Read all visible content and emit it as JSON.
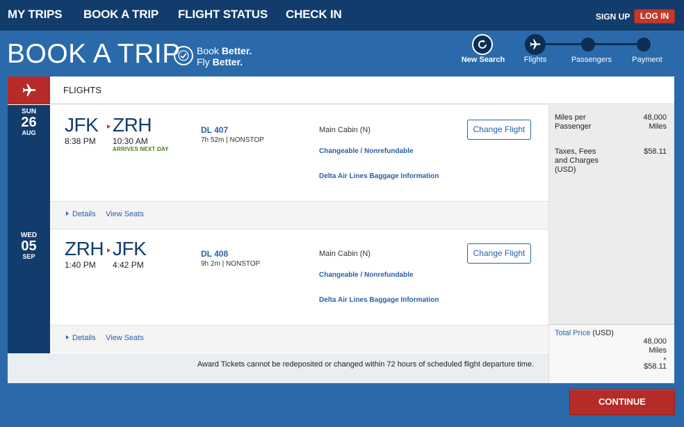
{
  "nav": {
    "items": [
      "MY TRIPS",
      "BOOK A TRIP",
      "FLIGHT STATUS",
      "CHECK IN"
    ],
    "sign_up": "SIGN UP",
    "log_in": "LOG IN"
  },
  "header": {
    "title": "BOOK A TRIP",
    "brand_line1_a": "Book ",
    "brand_line1_b": "Better.",
    "brand_line2_a": "Fly ",
    "brand_line2_b": "Better."
  },
  "steps": {
    "new_search": "New Search",
    "flights": "Flights",
    "passengers": "Passengers",
    "payment": "Payment"
  },
  "panel": {
    "section_label": "FLIGHTS"
  },
  "segments": [
    {
      "dow": "SUN",
      "day": "26",
      "month": "AUG",
      "from": "JFK",
      "to": "ZRH",
      "depart_time": "8:38 PM",
      "arrive_time": "10:30 AM",
      "arrives_note": "ARRIVES NEXT DAY",
      "flight_number": "DL 407",
      "duration": "7h 52m",
      "stops": "NONSTOP",
      "cabin": "Main Cabin (N)",
      "fare_rules": "Changeable / Nonrefundable",
      "baggage": "Delta Air Lines Baggage Information",
      "change_label": "Change Flight",
      "details_label": "Details",
      "seats_label": "View Seats"
    },
    {
      "dow": "WED",
      "day": "05",
      "month": "SEP",
      "from": "ZRH",
      "to": "JFK",
      "depart_time": "1:40 PM",
      "arrive_time": "4:42 PM",
      "flight_number": "DL 408",
      "duration": "9h 2m",
      "stops": "NONSTOP",
      "cabin": "Main Cabin (N)",
      "fare_rules": "Changeable / Nonrefundable",
      "baggage": "Delta Air Lines Baggage Information",
      "change_label": "Change Flight",
      "details_label": "Details",
      "seats_label": "View Seats"
    }
  ],
  "summary": {
    "miles_label_1": "Miles per",
    "miles_label_2": "Passenger",
    "miles_value": "48,000",
    "miles_unit": "Miles",
    "taxes_label_1": "Taxes, Fees",
    "taxes_label_2": "and Charges",
    "taxes_label_3": "(USD)",
    "taxes_value": "$58.11",
    "total_label": "Total Price",
    "total_currency": "(USD)",
    "total_miles": "48,000",
    "total_miles_unit": "Miles",
    "total_plus": "+",
    "total_cash": "$58.11"
  },
  "notice": "Award Tickets cannot be redeposited or changed within 72 hours of scheduled flight departure time.",
  "continue_label": "CONTINUE",
  "colors": {
    "nav_bg": "#123c6c",
    "page_bg": "#2a6aaa",
    "accent_red": "#b52b27",
    "link_blue": "#2a5fa8"
  }
}
